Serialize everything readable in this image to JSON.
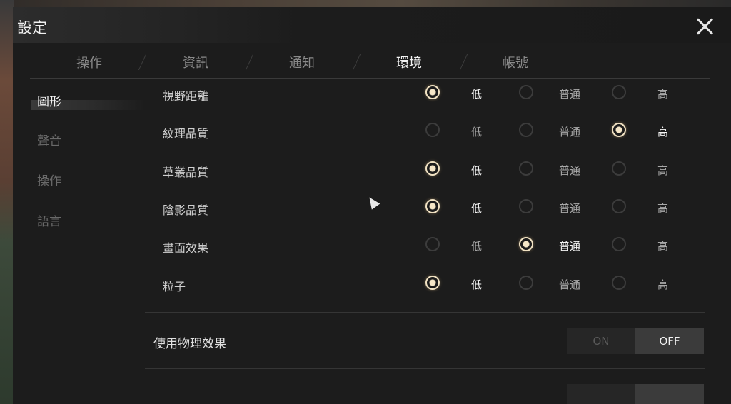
{
  "window": {
    "title": "設定"
  },
  "tabs": [
    {
      "label": "操作",
      "active": false
    },
    {
      "label": "資訊",
      "active": false
    },
    {
      "label": "通知",
      "active": false
    },
    {
      "label": "環境",
      "active": true
    },
    {
      "label": "帳號",
      "active": false
    }
  ],
  "sidebar": {
    "items": [
      {
        "label": "圖形",
        "active": true
      },
      {
        "label": "聲音",
        "active": false
      },
      {
        "label": "操作",
        "active": false
      },
      {
        "label": "語言",
        "active": false
      }
    ]
  },
  "options": {
    "low": "低",
    "normal": "普通",
    "high": "高"
  },
  "settings": [
    {
      "label": "視野距離",
      "selected": "low"
    },
    {
      "label": "紋理品質",
      "selected": "high"
    },
    {
      "label": "草叢品質",
      "selected": "low"
    },
    {
      "label": "陰影品質",
      "selected": "low"
    },
    {
      "label": "畫面效果",
      "selected": "normal"
    },
    {
      "label": "粒子",
      "selected": "low"
    }
  ],
  "physics": {
    "label": "使用物理效果",
    "on_label": "ON",
    "off_label": "OFF",
    "value": "OFF"
  },
  "colors": {
    "accent": "#f1e2c3",
    "panel": "#1c1c1c"
  }
}
